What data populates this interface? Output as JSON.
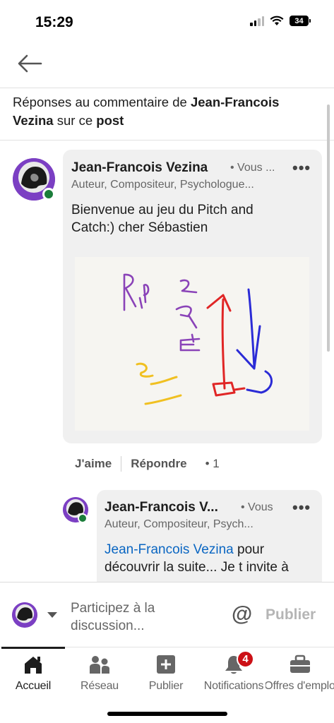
{
  "status_bar": {
    "time": "15:29",
    "battery": "34"
  },
  "header": {
    "prefix": "Réponses au commentaire de ",
    "author": "Jean-Francois Vezina",
    "middle": " sur ce ",
    "target": "post"
  },
  "comment": {
    "author": "Jean-Francois Vezina",
    "timestamp": "• Vous ...",
    "headline": "Auteur, Compositeur, Psychologue...",
    "text": "Bienvenue au jeu du Pitch and Catch:) cher Sébastien",
    "like_label": "J'aime",
    "reply_label": "Répondre",
    "like_count": "• 1",
    "more": "•••"
  },
  "reply": {
    "author": "Jean-Francois V...",
    "timestamp": "• Vous",
    "headline": "Auteur, Compositeur, Psych...",
    "mention": "Jean-Francois Vezina",
    "text": " pour découvrir la suite... Je t invite à",
    "more": "•••"
  },
  "composer": {
    "placeholder_line1": "Participez à la",
    "placeholder_line2": "discussion...",
    "at_symbol": "@",
    "publish_label": "Publier"
  },
  "tabs": [
    {
      "label": "Accueil",
      "icon": "home-icon",
      "active": true
    },
    {
      "label": "Réseau",
      "icon": "network-icon"
    },
    {
      "label": "Publier",
      "icon": "post-icon"
    },
    {
      "label": "Notifications",
      "icon": "bell-icon",
      "badge": "4"
    },
    {
      "label": "Offres d'emplo",
      "icon": "briefcase-icon"
    }
  ],
  "colors": {
    "accent": "#0a66c2",
    "online": "#1b7d3a",
    "badge": "#cc1016",
    "bubble": "#f0f0f0"
  }
}
